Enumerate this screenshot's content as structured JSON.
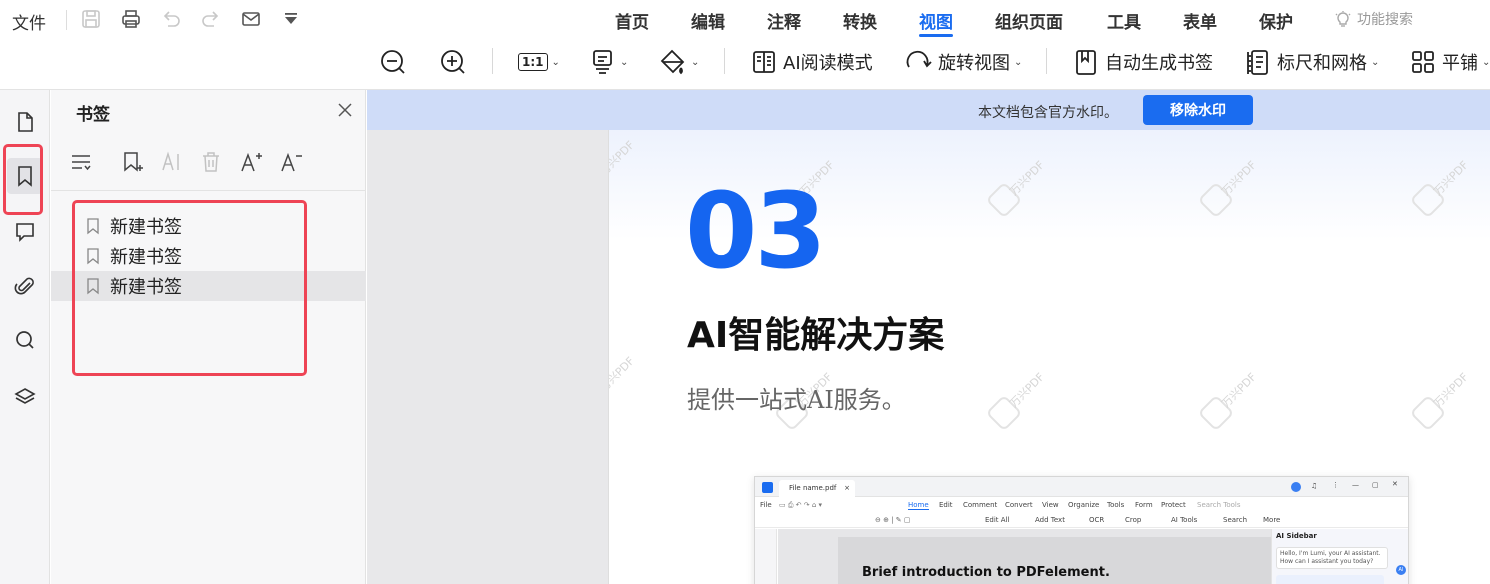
{
  "menu": {
    "file": "文件",
    "items": [
      "首页",
      "编辑",
      "注释",
      "转换",
      "视图",
      "组织页面",
      "工具",
      "表单",
      "保护"
    ],
    "active": "视图",
    "search_label": "功能搜索"
  },
  "view_toolbar": {
    "zoom_out": "zoom-out",
    "zoom_in": "zoom-in",
    "actual_size": "1:1",
    "ai_read_mode": "AI阅读模式",
    "rotate_view": "旋转视图",
    "auto_bookmarks": "自动生成书签",
    "ruler_grid": "标尺和网格",
    "tile": "平铺"
  },
  "panel": {
    "title": "书签",
    "bookmarks": [
      {
        "label": "新建书签",
        "selected": false
      },
      {
        "label": "新建书签",
        "selected": false
      },
      {
        "label": "新建书签",
        "selected": true
      }
    ]
  },
  "banner": {
    "message": "本文档包含官方水印。",
    "button": "移除水印",
    "color": "#1a6cf0"
  },
  "document": {
    "number": "03",
    "heading": "AI智能解决方案",
    "subtitle": "提供一站式AI服务。",
    "watermark": "万兴PDF",
    "number_color": "#1565f0"
  },
  "mini_screenshot": {
    "tab_label": "File name.pdf",
    "file_label": "File",
    "menus": [
      "Home",
      "Edit",
      "Comment",
      "Convert",
      "View",
      "Organize",
      "Tools",
      "Form",
      "Protect"
    ],
    "search_placeholder": "Search Tools",
    "tools": [
      "Edit All",
      "Add Text",
      "OCR",
      "Crop",
      "AI Tools",
      "Search",
      "More"
    ],
    "doc_title": "Brief introduction to PDFelement.",
    "ai_sidebar_title": "AI Sidebar",
    "ai_greeting": "Hello, I'm Lumi, your AI assistant. How can I assistant you today?"
  },
  "highlight_color": "#ee4455"
}
